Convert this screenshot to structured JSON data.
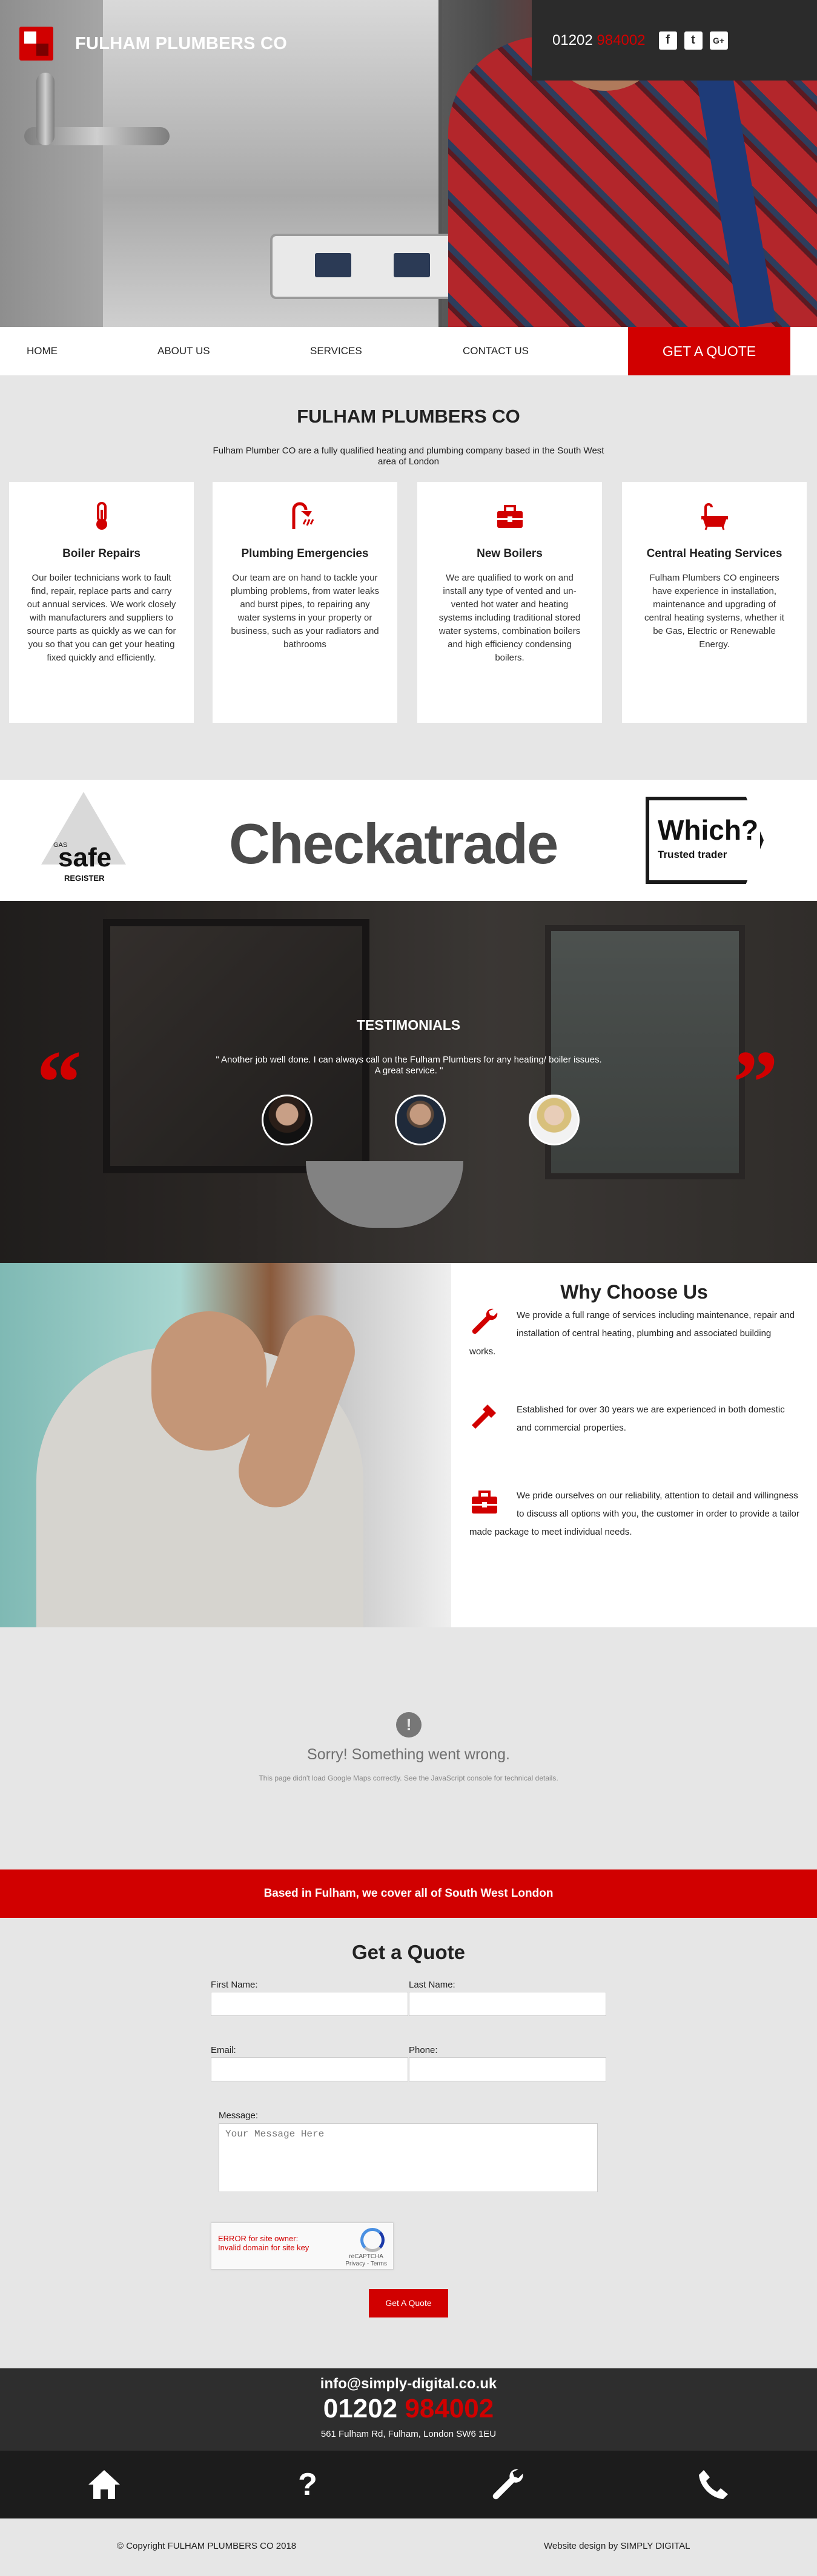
{
  "header": {
    "brand_name": "FULHAM PLUMBERS CO",
    "phone_prefix": "01202",
    "phone_suffix": "984002",
    "social": [
      "facebook-icon",
      "twitter-icon",
      "google-plus-icon"
    ]
  },
  "nav": {
    "items": [
      "HOME",
      "ABOUT US",
      "SERVICES",
      "CONTACT US"
    ],
    "cta": "GET A QUOTE"
  },
  "intro": {
    "title": "FULHAM PLUMBERS CO",
    "text": "Fulham Plumber CO are a fully qualified heating and plumbing company based in the South West area of London"
  },
  "services": [
    {
      "icon": "thermometer-icon",
      "title": "Boiler Repairs",
      "text": "Our boiler technicians work to fault find, repair, replace parts and carry out annual services. We work closely with manufacturers and suppliers to source parts as quickly as we can for you so that you can get your heating fixed quickly and efficiently."
    },
    {
      "icon": "shower-icon",
      "title": "Plumbing Emergencies",
      "text": "Our team are on hand to tackle your plumbing problems, from water leaks and burst pipes, to repairing any water systems in your property or business, such as your radiators and bathrooms"
    },
    {
      "icon": "toolbox-icon",
      "title": "New Boilers",
      "text": "We are qualified to work on and install any type of vented and un-vented hot water and heating systems including traditional stored water systems, combination boilers and high efficiency condensing boilers."
    },
    {
      "icon": "bathtub-icon",
      "title": "Central Heating Services",
      "text": "Fulham Plumbers CO engineers have experience in installation, maintenance and upgrading of central heating systems, whether it be Gas, Electric or Renewable Energy."
    }
  ],
  "logos": {
    "gas_small": "GAS",
    "gas_safe": "safe",
    "gas_register": "REGISTER",
    "checkatrade": "Checkatrade",
    "which_big": "Which?",
    "which_small": "Trusted trader"
  },
  "testimonials": {
    "title": "TESTIMONIALS",
    "quote": "\" Another job well done. I can always call on the Fulham Plumbers for any heating/ boiler issues. A great service. \""
  },
  "why": {
    "title": "Why Choose Us",
    "items": [
      {
        "icon": "wrench-icon",
        "text": "We provide a full range of services including maintenance, repair and installation of central heating, plumbing and associated building works."
      },
      {
        "icon": "pipe-wrench-icon",
        "text": "Established for over 30 years we are experienced in both domestic and commercial properties."
      },
      {
        "icon": "toolbox-icon",
        "text": "We pride ourselves on our reliability, attention to detail and willingness to discuss all options with you, the customer in order to provide a tailor made package to meet individual needs."
      }
    ]
  },
  "map": {
    "error_title": "Sorry! Something went wrong.",
    "error_sub": "This page didn't load Google Maps correctly. See the JavaScript console for technical details."
  },
  "banner": {
    "text": "Based in Fulham, we cover all of South West London"
  },
  "form": {
    "title": "Get a Quote",
    "first_name_label": "First Name:",
    "last_name_label": "Last Name:",
    "email_label": "Email:",
    "phone_label": "Phone:",
    "message_label": "Message:",
    "message_placeholder": "Your Message Here",
    "recaptcha_error_1": "ERROR for site owner:",
    "recaptcha_error_2": "Invalid domain for site key",
    "recaptcha_name": "reCAPTCHA",
    "recaptcha_links": "Privacy - Terms",
    "submit": "Get A Quote"
  },
  "footer": {
    "email": "info@simply-digital.co.uk",
    "phone_prefix": "01202",
    "phone_suffix": "984002",
    "address": "561 Fulham Rd, Fulham, London SW6 1EU",
    "icons": [
      "home-icon",
      "question-icon",
      "wrench-icon",
      "phone-icon"
    ],
    "copyright": "© Copyright FULHAM PLUMBERS CO 2018",
    "credit": "Website design by SIMPLY DIGITAL"
  },
  "colors": {
    "accent": "#d10000",
    "dark": "#2b2b2b",
    "background": "#e6e6e6"
  }
}
